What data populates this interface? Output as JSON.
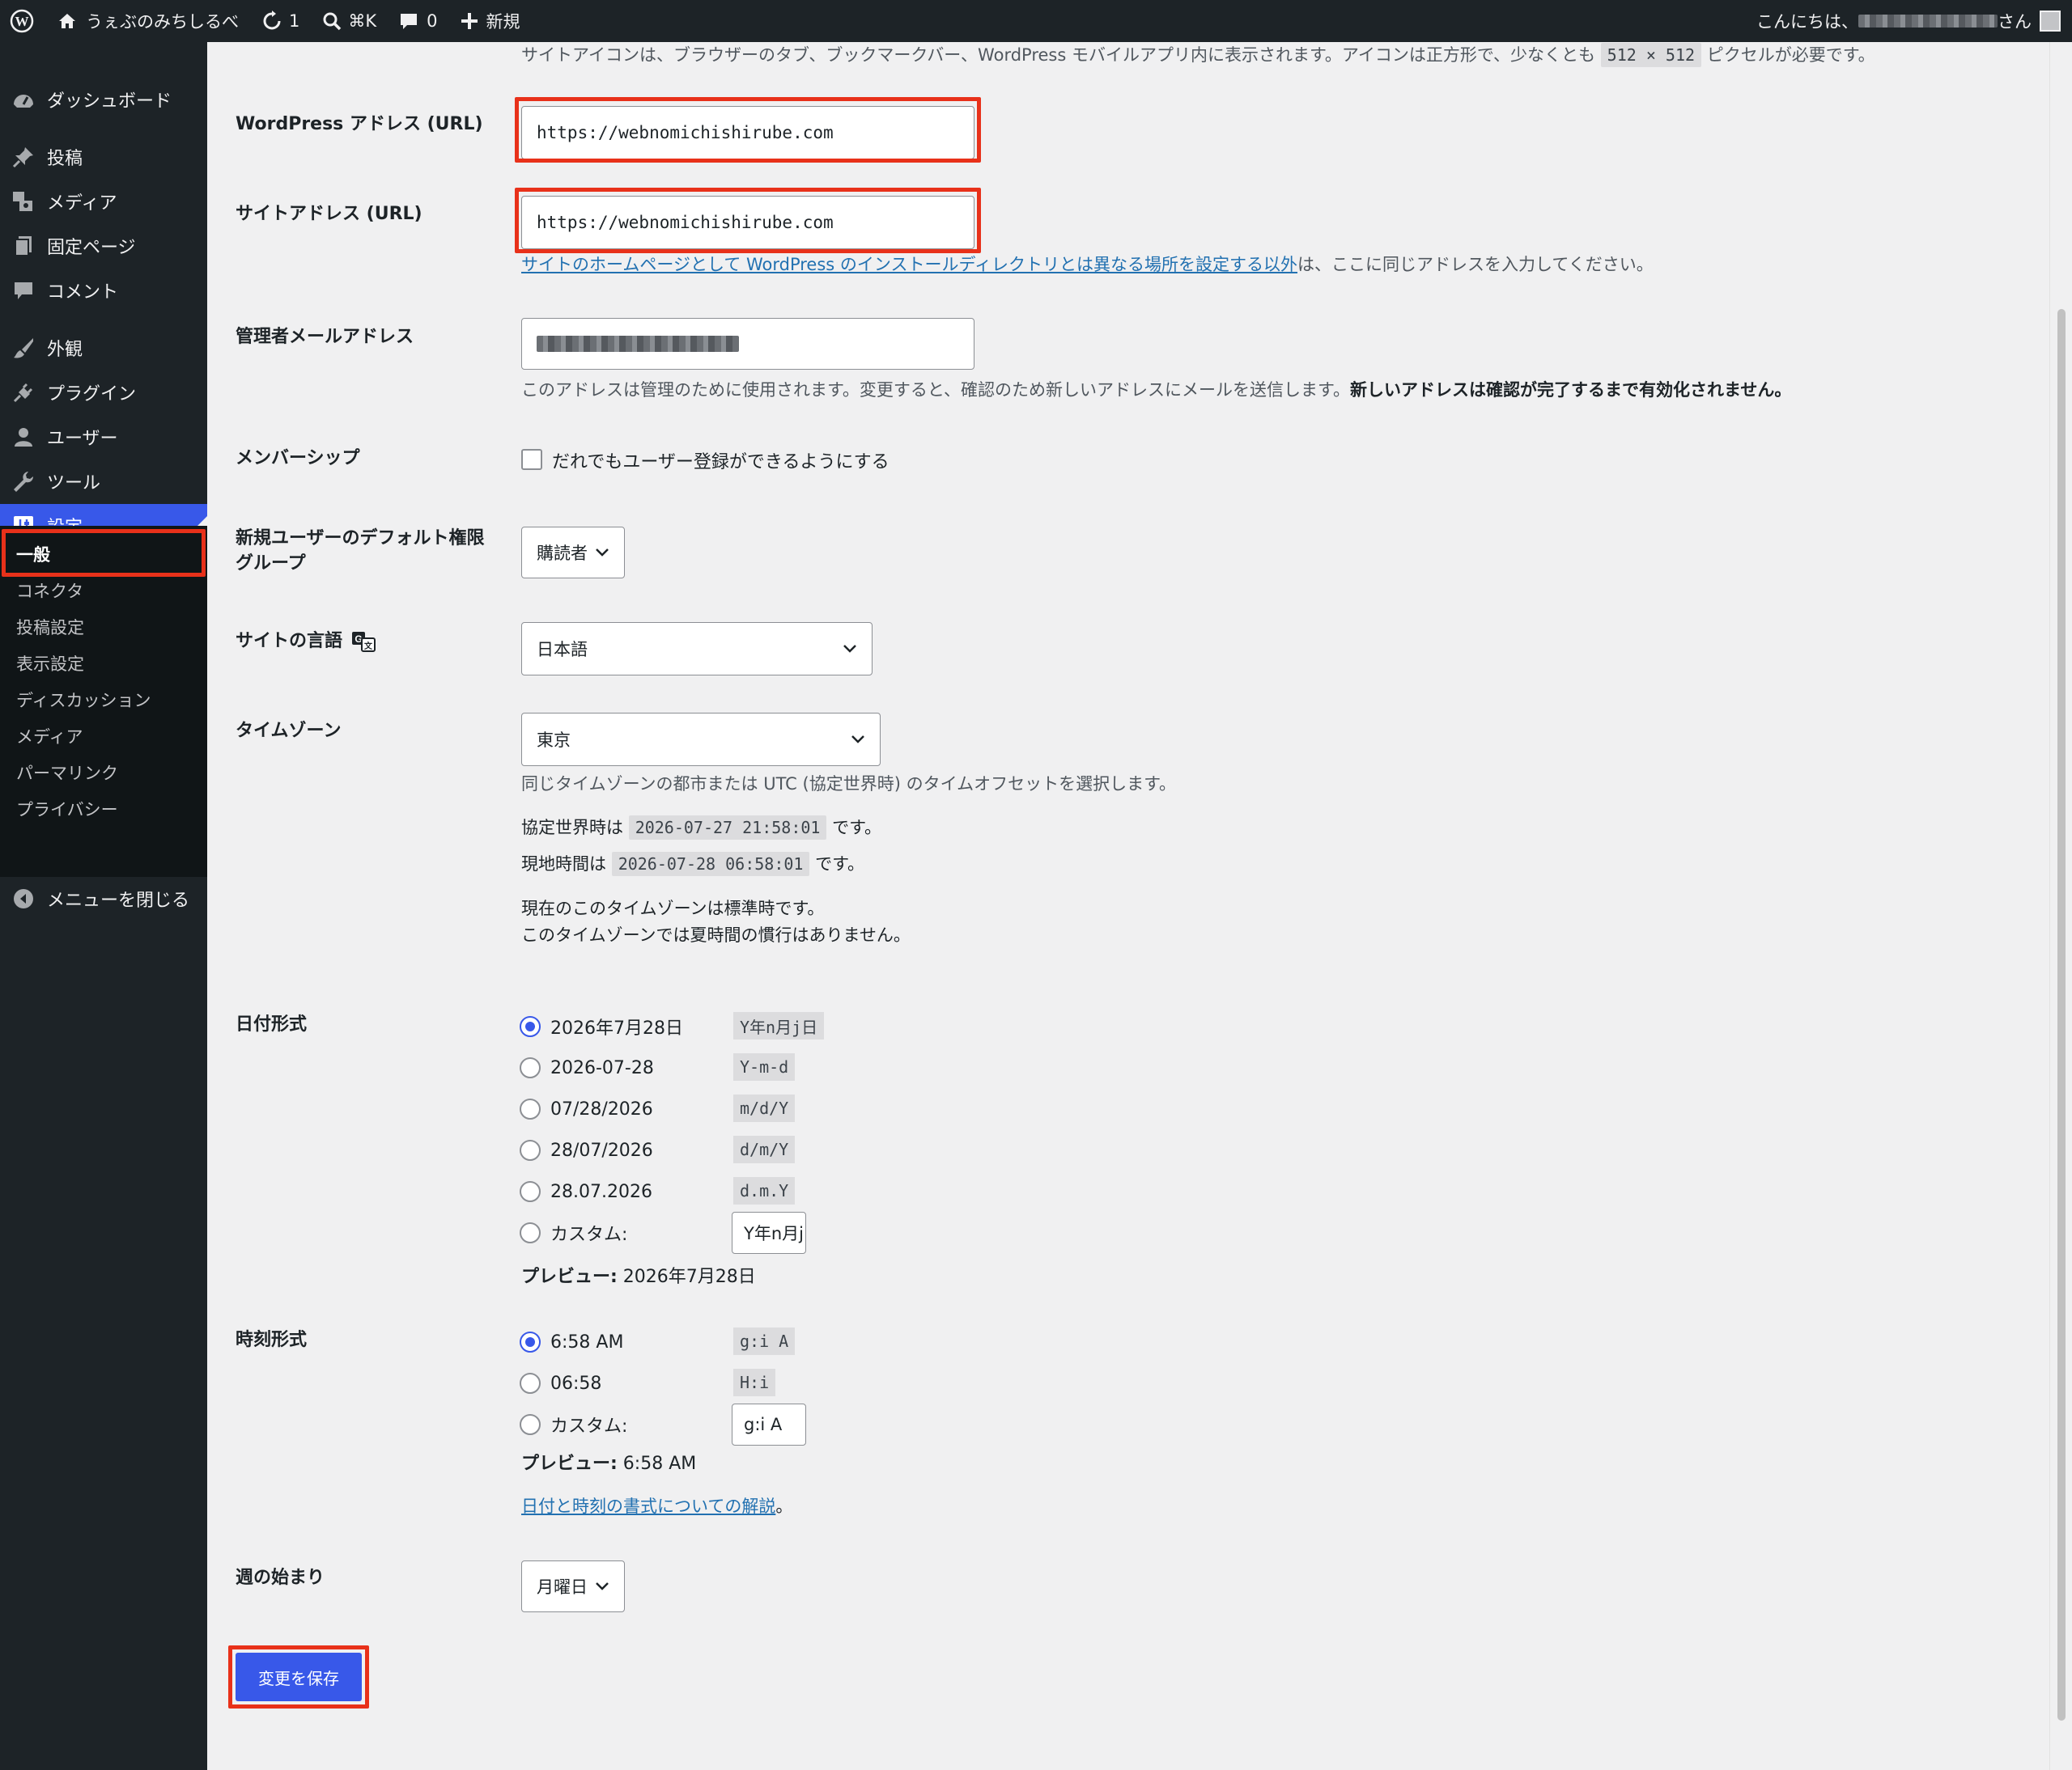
{
  "adminbar": {
    "site_name": "うぇぶのみちしるべ",
    "updates_count": "1",
    "search_shortcut": "⌘K",
    "comments_count": "0",
    "new_label": "新規",
    "greeting_prefix": "こんにちは、",
    "greeting_suffix": "さん"
  },
  "sidebar": {
    "items": [
      {
        "label": "ダッシュボード",
        "icon": "dashboard-icon"
      },
      {
        "label": "投稿",
        "icon": "pin-icon"
      },
      {
        "label": "メディア",
        "icon": "media-icon"
      },
      {
        "label": "固定ページ",
        "icon": "page-icon"
      },
      {
        "label": "コメント",
        "icon": "comment-icon"
      },
      {
        "label": "外観",
        "icon": "brush-icon"
      },
      {
        "label": "プラグイン",
        "icon": "plugin-icon"
      },
      {
        "label": "ユーザー",
        "icon": "user-icon"
      },
      {
        "label": "ツール",
        "icon": "wrench-icon"
      },
      {
        "label": "設定",
        "icon": "settings-icon"
      }
    ],
    "submenu": [
      "一般",
      "コネクタ",
      "投稿設定",
      "表示設定",
      "ディスカッション",
      "メディア",
      "パーマリンク",
      "プライバシー"
    ],
    "collapse_label": "メニューを閉じる"
  },
  "form": {
    "site_icon_desc_pre": "サイトアイコンは、ブラウザーのタブ、ブックマークバー、WordPress モバイルアプリ内に表示されます。アイコンは正方形で、少なくとも ",
    "site_icon_size": "512 × 512",
    "site_icon_desc_post": " ピクセルが必要です。",
    "wp_address_label": "WordPress アドレス (URL)",
    "wp_address_value": "https://webnomichishirube.com",
    "site_address_label": "サイトアドレス (URL)",
    "site_address_value": "https://webnomichishirube.com",
    "site_address_link": "サイトのホームページとして WordPress のインストールディレクトリとは異なる場所を設定する以外",
    "site_address_desc_post": "は、ここに同じアドレスを入力してください。",
    "admin_email_label": "管理者メールアドレス",
    "admin_email_desc": "このアドレスは管理のために使用されます。変更すると、確認のため新しいアドレスにメールを送信します。",
    "admin_email_desc_bold": "新しいアドレスは確認が完了するまで有効化されません。",
    "membership_label": "メンバーシップ",
    "membership_checkbox_label": "だれでもユーザー登録ができるようにする",
    "default_role_label_1": "新規ユーザーのデフォルト権限",
    "default_role_label_2": "グループ",
    "default_role_value": "購読者",
    "site_language_label": "サイトの言語",
    "site_language_value": "日本語",
    "timezone_label": "タイムゾーン",
    "timezone_value": "東京",
    "timezone_desc": "同じタイムゾーンの都市または UTC (協定世界時) のタイムオフセットを選択します。",
    "utc_time_pre": "協定世界時は ",
    "utc_time": "2026-07-27 21:58:01",
    "utc_time_post": " です。",
    "local_time_pre": "現地時間は ",
    "local_time": "2026-07-28 06:58:01",
    "local_time_post": " です。",
    "dst_line1": "現在のこのタイムゾーンは標準時です。",
    "dst_line2": "このタイムゾーンでは夏時間の慣行はありません。",
    "date_format_label": "日付形式",
    "date_formats": [
      {
        "display": "2026年7月28日",
        "code": "Y年n月j日",
        "checked": true
      },
      {
        "display": "2026-07-28",
        "code": "Y-m-d",
        "checked": false
      },
      {
        "display": "07/28/2026",
        "code": "m/d/Y",
        "checked": false
      },
      {
        "display": "28/07/2026",
        "code": "d/m/Y",
        "checked": false
      },
      {
        "display": "28.07.2026",
        "code": "d.m.Y",
        "checked": false
      }
    ],
    "custom_label": "カスタム:",
    "date_custom_value": "Y年n月j日",
    "preview_label": "プレビュー:",
    "date_preview": " 2026年7月28日",
    "time_format_label": "時刻形式",
    "time_formats": [
      {
        "display": "6:58 AM",
        "code": "g:i A",
        "checked": true
      },
      {
        "display": "06:58",
        "code": "H:i",
        "checked": false
      }
    ],
    "time_custom_value": "g:i A",
    "time_preview": " 6:58 AM",
    "format_doc_link": "日付と時刻の書式についての解説",
    "format_doc_post": "。",
    "week_start_label": "週の始まり",
    "week_start_value": "月曜日",
    "save_button": "変更を保存"
  },
  "colors": {
    "adminbar_bg": "#1d2327",
    "accent": "#3858e9",
    "highlight": "#e8311a",
    "link": "#2271b1"
  }
}
